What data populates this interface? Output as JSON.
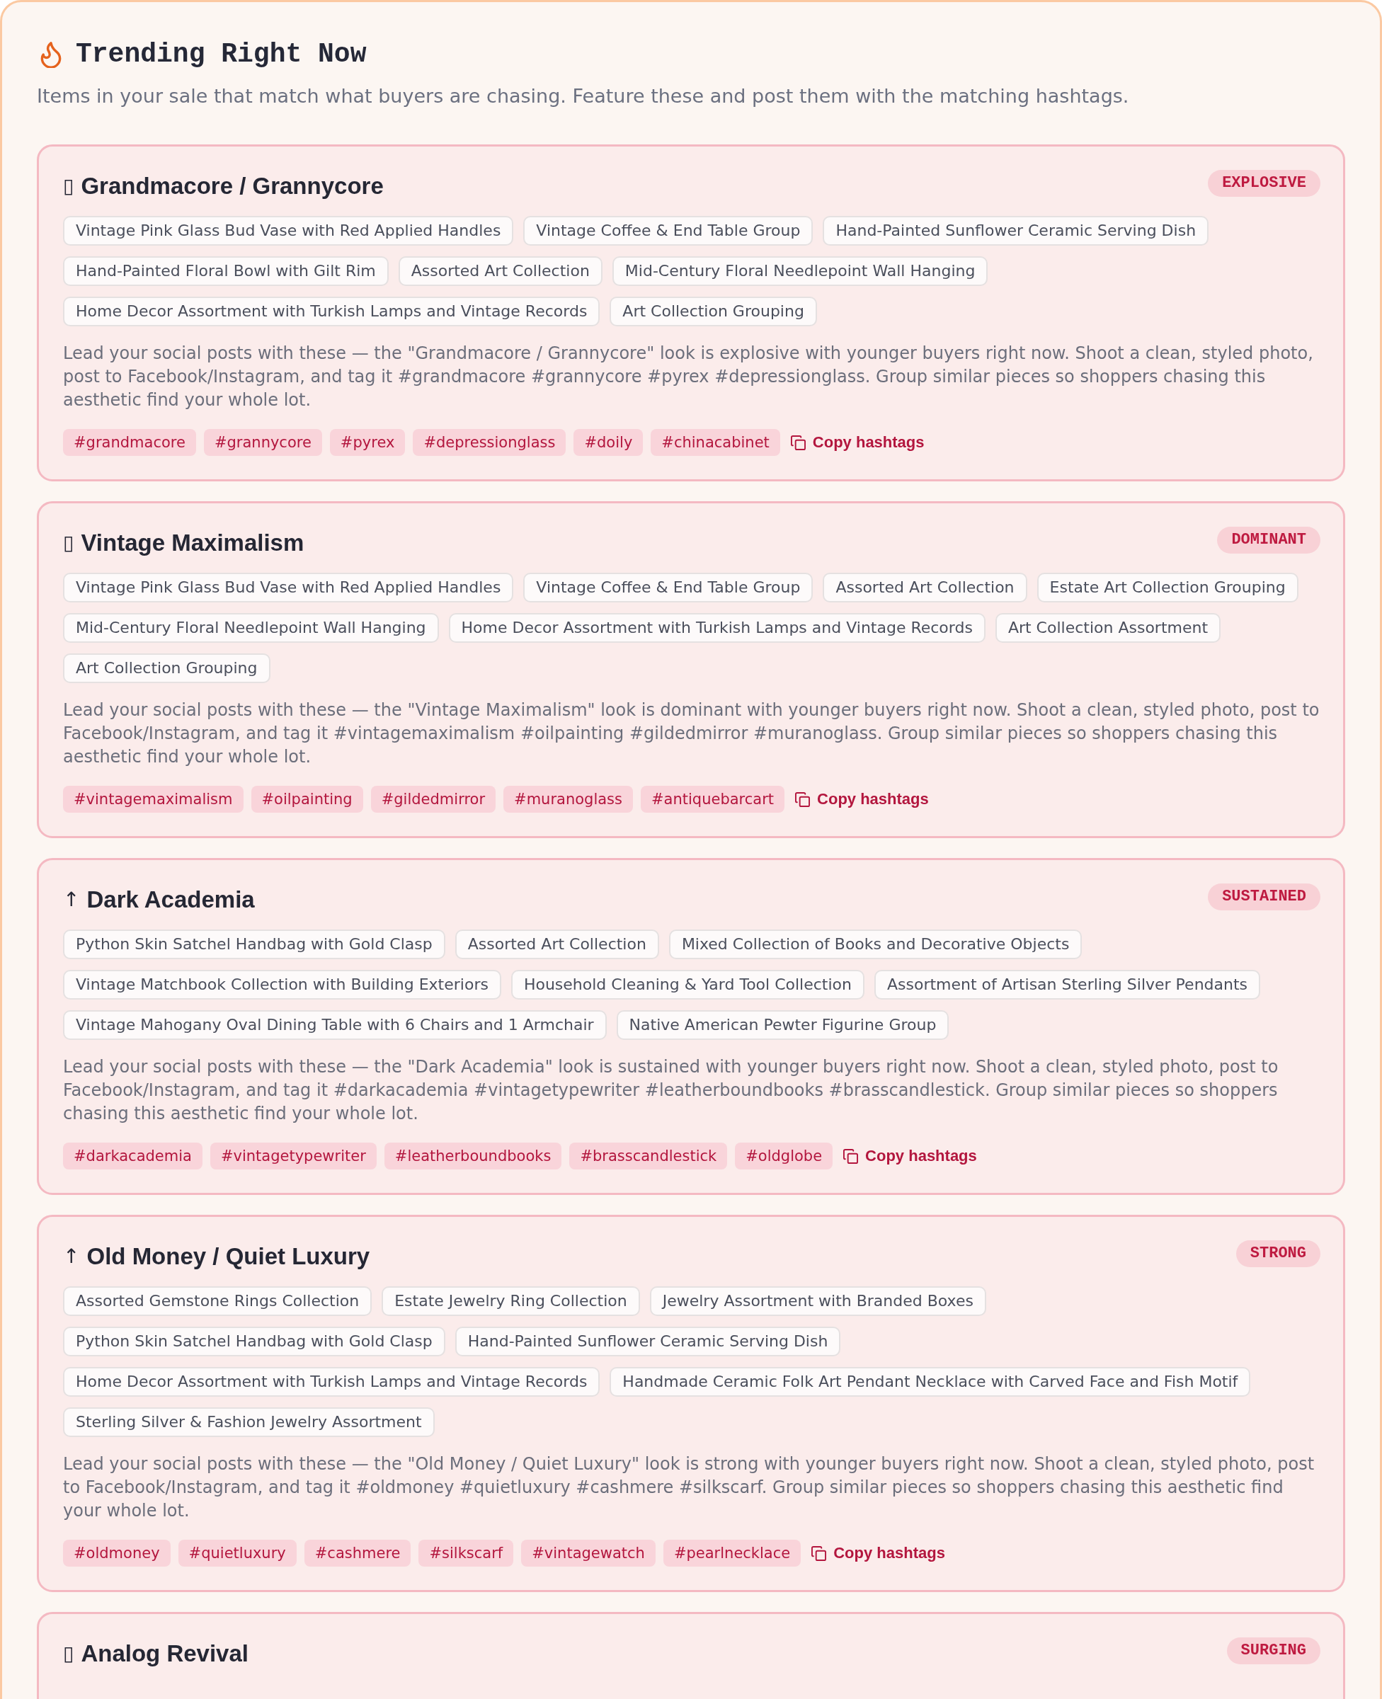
{
  "header": {
    "title": "Trending Right Now",
    "subtitle": "Items in your sale that match what buyers are chasing. Feature these and post them with the matching hashtags."
  },
  "trends": [
    {
      "symbol": "▯",
      "name": "Grandmacore / Grannycore",
      "badge": "EXPLOSIVE",
      "items": [
        "Vintage Pink Glass Bud Vase with Red Applied Handles",
        "Vintage Coffee & End Table Group",
        "Hand-Painted Sunflower Ceramic Serving Dish",
        "Hand-Painted Floral Bowl with Gilt Rim",
        "Assorted Art Collection",
        "Mid-Century Floral Needlepoint Wall Hanging",
        "Home Decor Assortment with Turkish Lamps and Vintage Records",
        "Art Collection Grouping"
      ],
      "description": "Lead your social posts with these — the \"Grandmacore / Grannycore\" look is explosive with younger buyers right now. Shoot a clean, styled photo, post to Facebook/Instagram, and tag it #grandmacore #grannycore #pyrex #depressionglass. Group similar pieces so shoppers chasing this aesthetic find your whole lot.",
      "hashtags": [
        "#grandmacore",
        "#grannycore",
        "#pyrex",
        "#depressionglass",
        "#doily",
        "#chinacabinet"
      ],
      "copy_button": "Copy hashtags"
    },
    {
      "symbol": "▯",
      "name": "Vintage Maximalism",
      "badge": "DOMINANT",
      "items": [
        "Vintage Pink Glass Bud Vase with Red Applied Handles",
        "Vintage Coffee & End Table Group",
        "Assorted Art Collection",
        "Estate Art Collection Grouping",
        "Mid-Century Floral Needlepoint Wall Hanging",
        "Home Decor Assortment with Turkish Lamps and Vintage Records",
        "Art Collection Assortment",
        "Art Collection Grouping"
      ],
      "description": "Lead your social posts with these — the \"Vintage Maximalism\" look is dominant with younger buyers right now. Shoot a clean, styled photo, post to Facebook/Instagram, and tag it #vintagemaximalism #oilpainting #gildedmirror #muranoglass. Group similar pieces so shoppers chasing this aesthetic find your whole lot.",
      "hashtags": [
        "#vintagemaximalism",
        "#oilpainting",
        "#gildedmirror",
        "#muranoglass",
        "#antiquebarcart"
      ],
      "copy_button": "Copy hashtags"
    },
    {
      "symbol": "↑",
      "name": "Dark Academia",
      "badge": "SUSTAINED",
      "items": [
        "Python Skin Satchel Handbag with Gold Clasp",
        "Assorted Art Collection",
        "Mixed Collection of Books and Decorative Objects",
        "Vintage Matchbook Collection with Building Exteriors",
        "Household Cleaning & Yard Tool Collection",
        "Assortment of Artisan Sterling Silver Pendants",
        "Vintage Mahogany Oval Dining Table with 6 Chairs and 1 Armchair",
        "Native American Pewter Figurine Group"
      ],
      "description": "Lead your social posts with these — the \"Dark Academia\" look is sustained with younger buyers right now. Shoot a clean, styled photo, post to Facebook/Instagram, and tag it #darkacademia #vintagetypewriter #leatherboundbooks #brasscandlestick. Group similar pieces so shoppers chasing this aesthetic find your whole lot.",
      "hashtags": [
        "#darkacademia",
        "#vintagetypewriter",
        "#leatherboundbooks",
        "#brasscandlestick",
        "#oldglobe"
      ],
      "copy_button": "Copy hashtags"
    },
    {
      "symbol": "↑",
      "name": "Old Money / Quiet Luxury",
      "badge": "STRONG",
      "items": [
        "Assorted Gemstone Rings Collection",
        "Estate Jewelry Ring Collection",
        "Jewelry Assortment with Branded Boxes",
        "Python Skin Satchel Handbag with Gold Clasp",
        "Hand-Painted Sunflower Ceramic Serving Dish",
        "Home Decor Assortment with Turkish Lamps and Vintage Records",
        "Handmade Ceramic Folk Art Pendant Necklace with Carved Face and Fish Motif",
        "Sterling Silver & Fashion Jewelry Assortment"
      ],
      "description": "Lead your social posts with these — the \"Old Money / Quiet Luxury\" look is strong with younger buyers right now. Shoot a clean, styled photo, post to Facebook/Instagram, and tag it #oldmoney #quietluxury #cashmere #silkscarf. Group similar pieces so shoppers chasing this aesthetic find your whole lot.",
      "hashtags": [
        "#oldmoney",
        "#quietluxury",
        "#cashmere",
        "#silkscarf",
        "#vintagewatch",
        "#pearlnecklace"
      ],
      "copy_button": "Copy hashtags"
    },
    {
      "symbol": "▯",
      "name": "Analog Revival",
      "badge": "SURGING"
    }
  ]
}
